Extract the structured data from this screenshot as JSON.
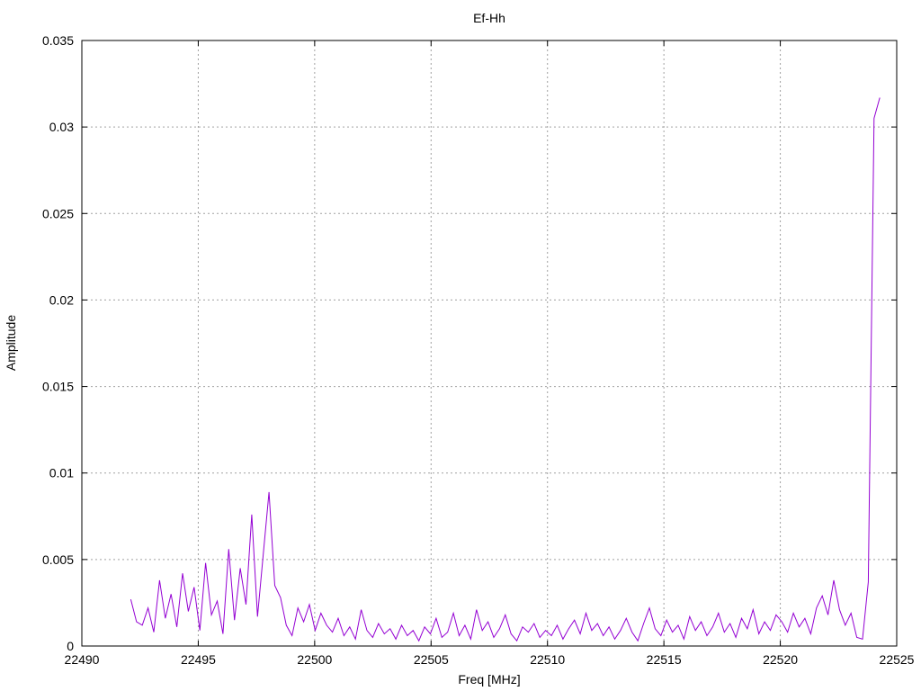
{
  "chart_data": {
    "type": "line",
    "title": "Ef-Hh",
    "xlabel": "Freq [MHz]",
    "ylabel": "Amplitude",
    "xlim": [
      22490,
      22525
    ],
    "ylim": [
      0,
      0.035
    ],
    "grid": true,
    "x_ticks": [
      "22490",
      "22495",
      "22500",
      "22505",
      "22510",
      "22515",
      "22520",
      "22525"
    ],
    "y_ticks": [
      "0",
      "0.005",
      "0.01",
      "0.015",
      "0.02",
      "0.025",
      "0.03",
      "0.035"
    ],
    "series": [
      {
        "name": "Ef-Hh",
        "color": "#9400d3",
        "x_start": 22492.1,
        "x_step": 0.2475,
        "values": [
          0.0027,
          0.0014,
          0.0012,
          0.0022,
          0.0008,
          0.0038,
          0.0016,
          0.003,
          0.0011,
          0.0042,
          0.002,
          0.0034,
          0.0009,
          0.0048,
          0.0018,
          0.0026,
          0.0007,
          0.0056,
          0.0015,
          0.0045,
          0.0024,
          0.0076,
          0.0017,
          0.0053,
          0.0089,
          0.0035,
          0.0028,
          0.0012,
          0.0006,
          0.0022,
          0.0014,
          0.0024,
          0.0009,
          0.0019,
          0.0012,
          0.0008,
          0.0016,
          0.0006,
          0.0011,
          0.0004,
          0.0021,
          0.0009,
          0.0005,
          0.0013,
          0.0007,
          0.001,
          0.0004,
          0.0012,
          0.0006,
          0.0009,
          0.0003,
          0.0011,
          0.0007,
          0.0016,
          0.0005,
          0.0008,
          0.0019,
          0.0006,
          0.0012,
          0.0004,
          0.0021,
          0.0009,
          0.0014,
          0.0005,
          0.001,
          0.0018,
          0.0007,
          0.0003,
          0.0011,
          0.0008,
          0.0013,
          0.0005,
          0.0009,
          0.0006,
          0.0012,
          0.0004,
          0.001,
          0.0015,
          0.0007,
          0.0019,
          0.0009,
          0.0013,
          0.0006,
          0.0011,
          0.0004,
          0.0009,
          0.0016,
          0.0008,
          0.0003,
          0.0013,
          0.0022,
          0.001,
          0.0006,
          0.0015,
          0.0008,
          0.0012,
          0.0004,
          0.0017,
          0.0009,
          0.0014,
          0.0006,
          0.0011,
          0.0019,
          0.0008,
          0.0013,
          0.0005,
          0.0016,
          0.001,
          0.0021,
          0.0007,
          0.0014,
          0.0009,
          0.0018,
          0.0014,
          0.0008,
          0.0019,
          0.0011,
          0.0016,
          0.0007,
          0.0022,
          0.0029,
          0.0018,
          0.0038,
          0.0021,
          0.0012,
          0.0019,
          0.0005,
          0.0004,
          0.0037,
          0.0305,
          0.0317
        ]
      }
    ]
  }
}
